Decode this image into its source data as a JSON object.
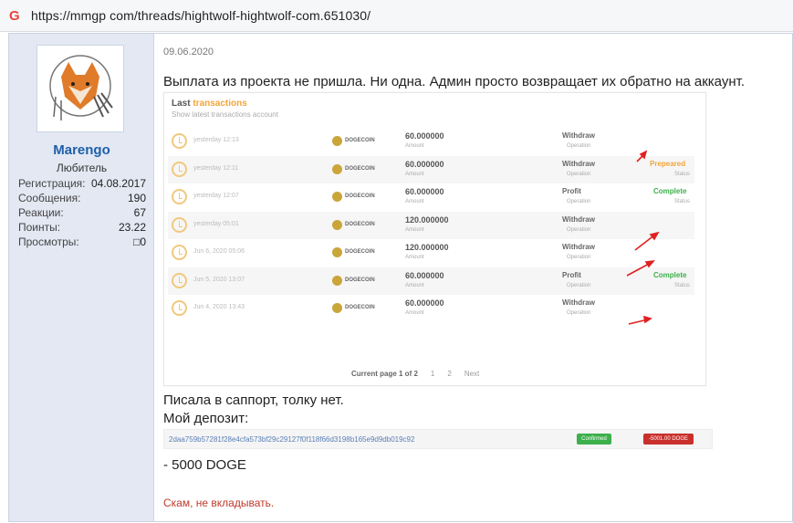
{
  "browser": {
    "icon": "google-g-icon",
    "url": "https://mmgp com/threads/hightwolf-hightwolf-com.651030/"
  },
  "user": {
    "avatar": "fox-dreamcatcher-avatar",
    "name": "Marengo",
    "title": "Любитель",
    "stats": [
      {
        "label": "Регистрация:",
        "value": "04.08.2017"
      },
      {
        "label": "Сообщения:",
        "value": "190"
      },
      {
        "label": "Реакции:",
        "value": "67"
      },
      {
        "label": "Поинты:",
        "value": "23.22"
      },
      {
        "label": "Просмотры:",
        "value": "□0"
      }
    ]
  },
  "post": {
    "date": "09.06.2020",
    "p1": "Выплата из проекта не пришла. Ни одна. Админ просто возвращает их обратно на аккаунт.",
    "p2": "Писала в саппорт, толку нет.",
    "p3": "Мой депозит:",
    "p4": "- 5000 DOGE",
    "p5": "Скам, не вкладывать."
  },
  "tx": {
    "title_a": "Last",
    "title_b": "transactions",
    "subtitle": "Show latest transactions account",
    "coin_label": "DOGECOIN",
    "amount_label": "Amount",
    "op_label": "Operation",
    "status_label": "Status",
    "rows": [
      {
        "when": "yesterday 12:13",
        "amount": "60.000000",
        "op": "Withdraw",
        "status": "",
        "status_label": ""
      },
      {
        "when": "yesterday 12:11",
        "amount": "60.000000",
        "op": "Withdraw",
        "status": "Prepeared",
        "status_label": "Status"
      },
      {
        "when": "yesterday 12:07",
        "amount": "60.000000",
        "op": "Profit",
        "status": "Complete",
        "status_label": "Status"
      },
      {
        "when": "yesterday 05:01",
        "amount": "120.000000",
        "op": "Withdraw",
        "status": "",
        "status_label": ""
      },
      {
        "when": "Jun 6, 2020 05:06",
        "amount": "120.000000",
        "op": "Withdraw",
        "status": "",
        "status_label": ""
      },
      {
        "when": "Jun 5, 2020 13:07",
        "amount": "60.000000",
        "op": "Profit",
        "status": "Complete",
        "status_label": "Status"
      },
      {
        "when": "Jun 4, 2020 13:43",
        "amount": "60.000000",
        "op": "Withdraw",
        "status": "",
        "status_label": ""
      }
    ],
    "pager": {
      "current": "Current page 1 of 2",
      "p1": "1",
      "p2": "2",
      "next": "Next"
    }
  },
  "deposit": {
    "hash": "2daa759b57281f28e4cfa573bf29c29127f0f118f66d3198b165e9d9db019c92",
    "confirmed": "Confirmed",
    "amount": "-5001.00 DOGE"
  },
  "colors": {
    "accent": "#1f5fa8",
    "prepared": "#f2a53a",
    "complete": "#3db04b",
    "warning": "#c0392b"
  }
}
